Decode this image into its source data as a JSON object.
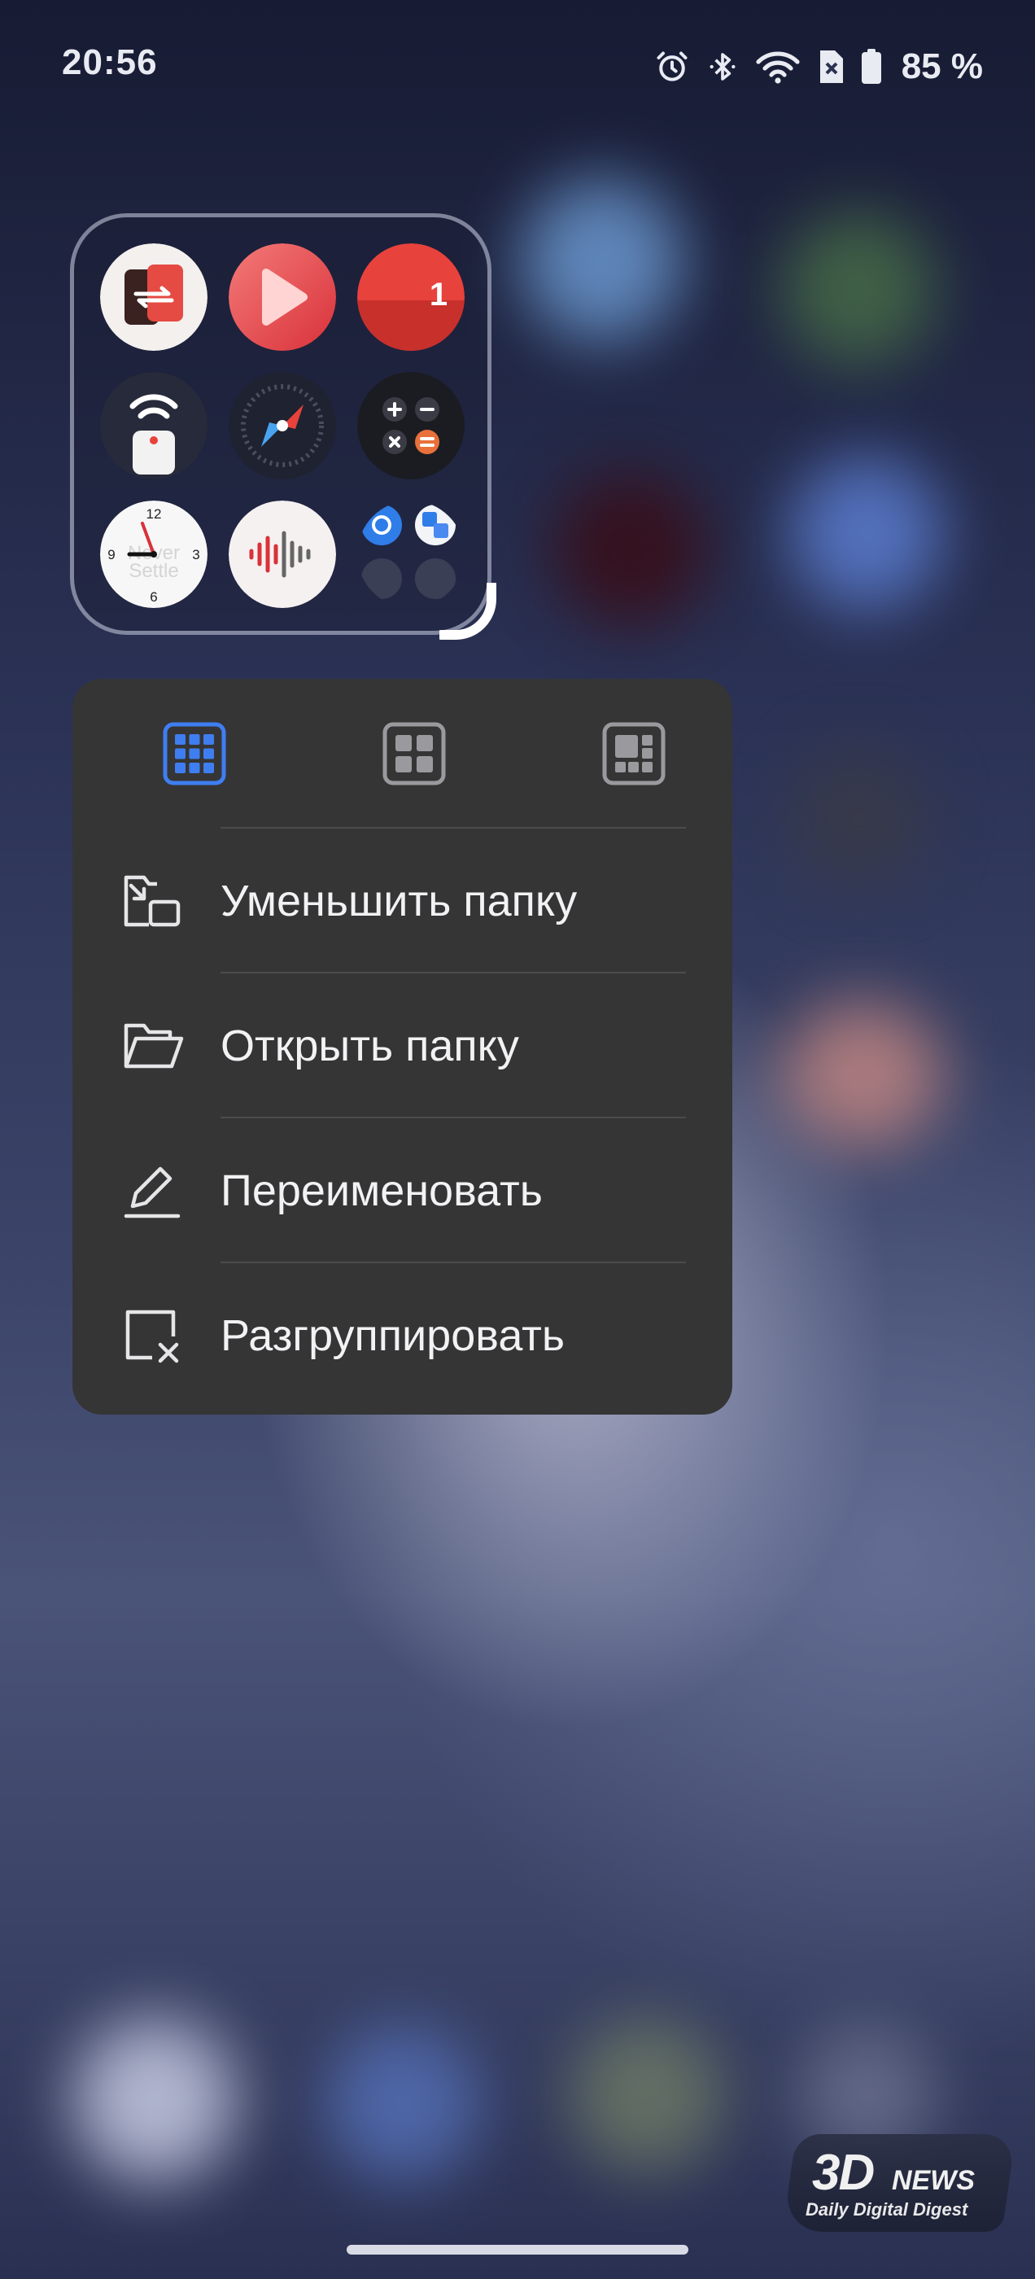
{
  "status_bar": {
    "time": "20:56",
    "icons": [
      "alarm-icon",
      "bluetooth-icon",
      "wifi-icon",
      "no-sim-icon",
      "battery-icon"
    ],
    "battery": "85 %"
  },
  "folder": {
    "apps": [
      {
        "icon": "clone-phone-icon"
      },
      {
        "icon": "video-player-icon"
      },
      {
        "icon": "messages-icon",
        "badge": "1"
      },
      {
        "icon": "remote-control-icon"
      },
      {
        "icon": "compass-icon"
      },
      {
        "icon": "calculator-icon"
      },
      {
        "icon": "clock-icon"
      },
      {
        "icon": "recorder-icon"
      },
      {
        "icon": "more-apps-icon"
      }
    ],
    "clock_numbers": [
      "12",
      "3",
      "6",
      "9"
    ],
    "clock_watermark": [
      "Never",
      "Settle"
    ]
  },
  "context_menu": {
    "layout_options": [
      {
        "icon": "grid-3x3-icon",
        "selected": true
      },
      {
        "icon": "grid-2x2-icon",
        "selected": false
      },
      {
        "icon": "grid-mixed-icon",
        "selected": false
      }
    ],
    "items": [
      {
        "label": "Уменьшить папку",
        "icon": "shrink-folder-icon"
      },
      {
        "label": "Открыть папку",
        "icon": "open-folder-icon"
      },
      {
        "label": "Переименовать",
        "icon": "pencil-icon"
      },
      {
        "label": "Разгруппировать",
        "icon": "ungroup-icon"
      }
    ]
  },
  "watermark": {
    "brand_big": "3D",
    "brand_news": "NEWS",
    "tagline": "Daily Digital Digest"
  },
  "colors": {
    "menu_bg": "#353536",
    "accent": "#3f7ef0",
    "text": "#f2f2f4"
  }
}
